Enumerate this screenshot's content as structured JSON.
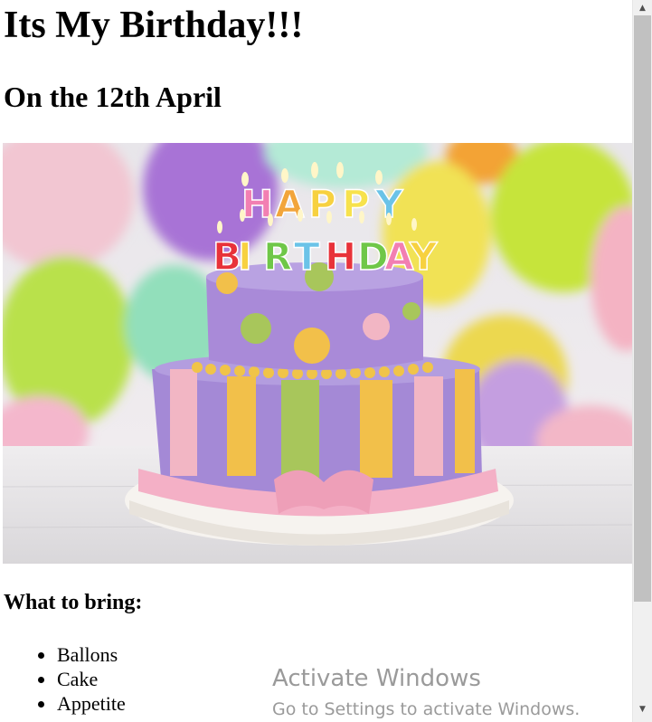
{
  "page": {
    "title": "Its My Birthday!!!",
    "subtitle": "On the 12th April",
    "bring_heading": "What to bring:",
    "bring_items": [
      "Ballons",
      "Cake",
      "Appetite"
    ]
  },
  "image": {
    "description_icon": "birthday-cake-image",
    "candle_letters": [
      "H",
      "A",
      "P",
      "P",
      "Y",
      "B",
      "I",
      "R",
      "T",
      "H",
      "D",
      "A",
      "Y"
    ]
  },
  "watermark": {
    "title": "Activate Windows",
    "subtitle": "Go to Settings to activate Windows."
  },
  "scrollbar": {
    "up_icon": "▲",
    "down_icon": "▼"
  }
}
